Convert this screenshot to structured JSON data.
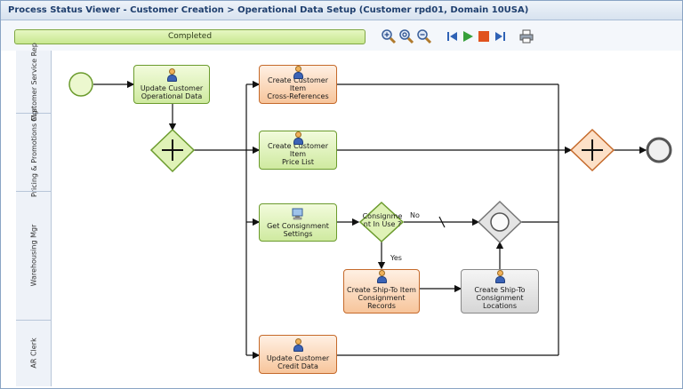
{
  "window": {
    "title": "Process Status Viewer - Customer Creation > Operational Data Setup (Customer rpd01, Domain 10USA)"
  },
  "toolbar": {
    "status": "Completed",
    "icons": [
      "zoom-in-icon",
      "zoom-reset-icon",
      "zoom-out-icon",
      "first-icon",
      "play-icon",
      "stop-icon",
      "last-icon",
      "print-icon"
    ]
  },
  "lanes": [
    {
      "label": "Customer Service Rep"
    },
    {
      "label": "Pricing & Promotions Mgr"
    },
    {
      "label": "Warehousing Mgr"
    },
    {
      "label": "AR Clerk"
    }
  ],
  "tasks": {
    "update_operational": "Update Customer\nOperational Data",
    "cross_references": "Create Customer Item\nCross-References",
    "price_list": "Create Customer Item\nPrice List",
    "consignment_settings": "Get Consignment\nSettings",
    "ship_to_records": "Create Ship-To Item\nConsignment\nRecords",
    "ship_to_locations": "Create Ship-To\nConsignment\nLocations",
    "credit_data": "Update Customer\nCredit Data"
  },
  "gateway": {
    "question": "Consignme\nnt In Use ?",
    "yes": "Yes",
    "no": "No"
  }
}
